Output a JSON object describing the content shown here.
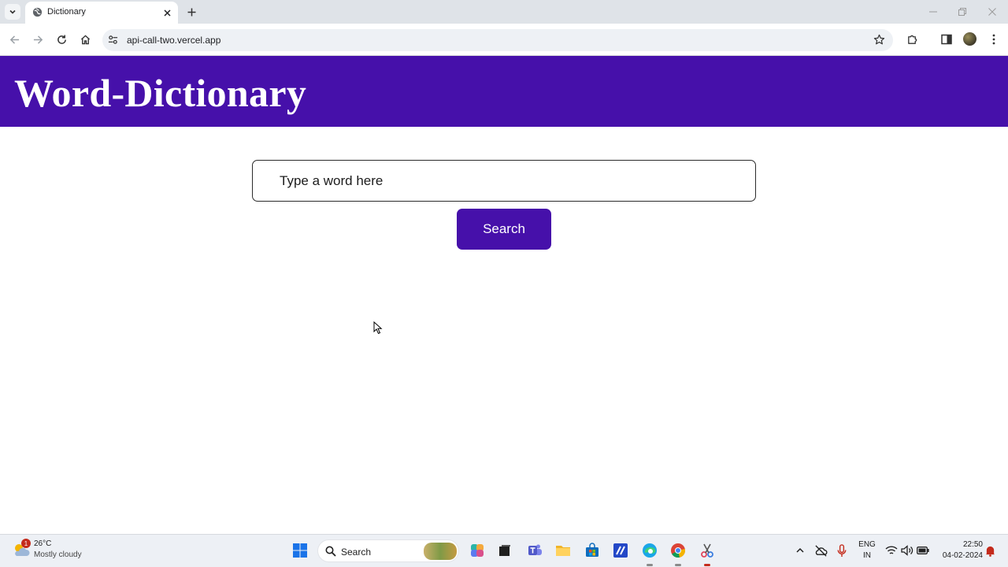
{
  "browser": {
    "tab_title": "Dictionary",
    "url": "api-call-two.vercel.app"
  },
  "page": {
    "title": "Word-Dictionary",
    "input_placeholder": "Type a word here",
    "search_label": "Search"
  },
  "taskbar": {
    "weather_temp": "26°C",
    "weather_condition": "Mostly cloudy",
    "weather_badge": "1",
    "search_label": "Search",
    "lang_top": "ENG",
    "lang_bottom": "IN",
    "time": "22:50",
    "date": "04-02-2024"
  },
  "colors": {
    "brand": "#4610aa",
    "tab_strip": "#dfe3e8",
    "taskbar": "#edf0f5"
  }
}
